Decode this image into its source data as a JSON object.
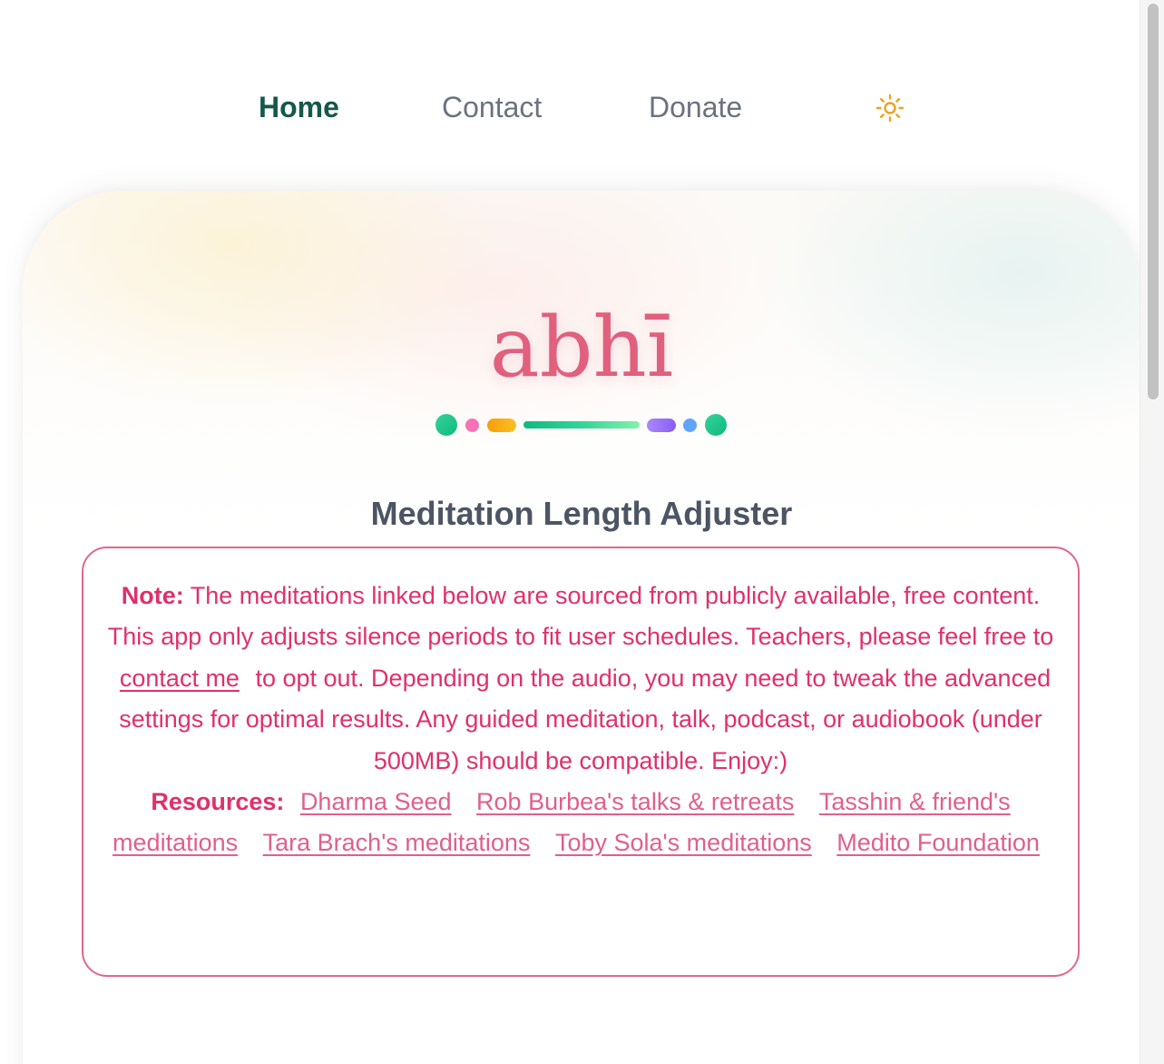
{
  "nav": {
    "items": [
      {
        "label": "Home",
        "active": true
      },
      {
        "label": "Contact",
        "active": false
      },
      {
        "label": "Donate",
        "active": false
      }
    ],
    "theme_toggle_icon": "sun-icon"
  },
  "brand": {
    "logo_text": "abhī",
    "accent_color": "#e0607e"
  },
  "header": {
    "title": "Meditation Length Adjuster"
  },
  "note": {
    "label": "Note:",
    "text_before_link": "The meditations linked below are sourced from publicly available, free content. This app only adjusts silence periods to fit user schedules. Teachers, please feel free to",
    "contact_link": "contact me",
    "text_after_link": "to opt out. Depending on the audio, you may need to tweak the advanced settings for optimal results. Any guided meditation, talk, podcast, or audiobook (under 500MB) should be compatible. Enjoy:)",
    "resources_label": "Resources:",
    "resources": [
      "Dharma Seed",
      "Rob Burbea's talks & retreats",
      "Tasshin & friend's meditations",
      "Tara Brach's meditations",
      "Toby Sola's meditations",
      "Medito Foundation"
    ],
    "color": "#e0306a"
  }
}
